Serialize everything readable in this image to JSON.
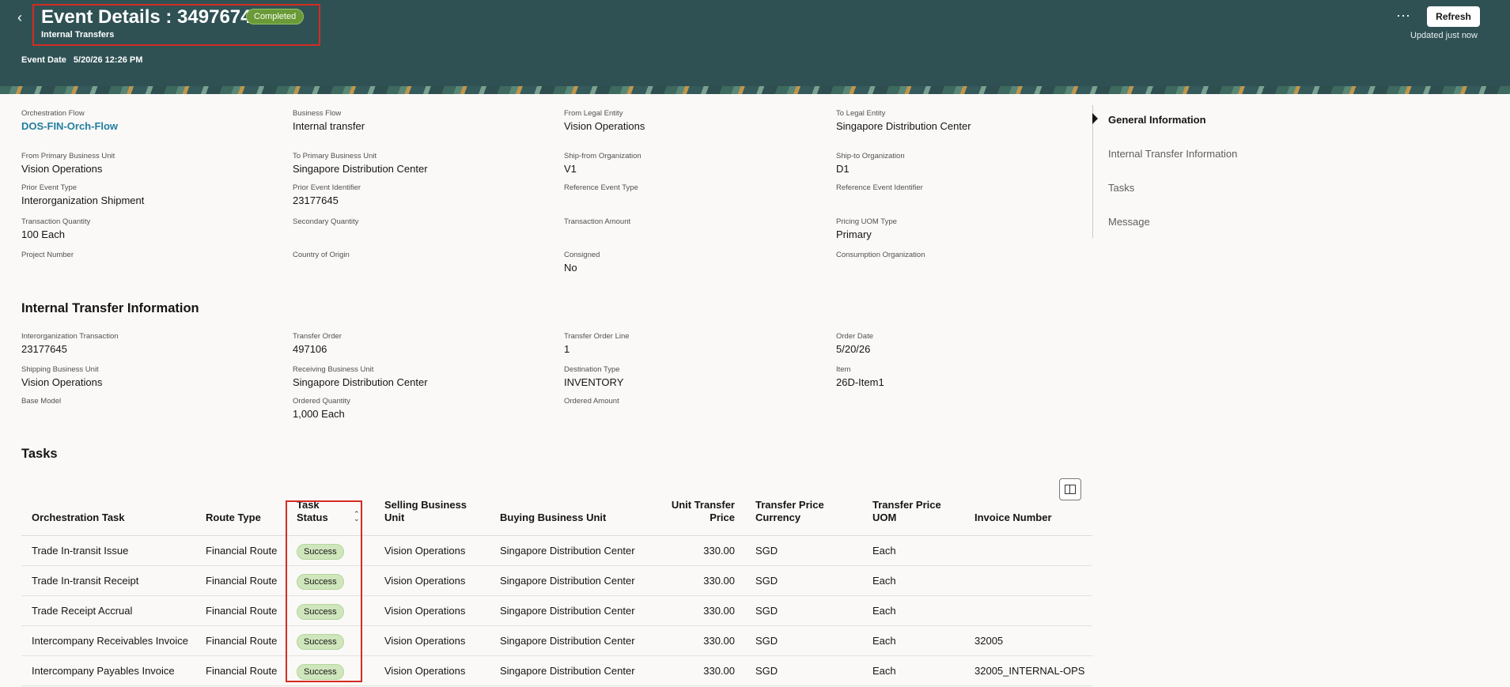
{
  "header": {
    "title": "Event Details : 3497674",
    "status": "Completed",
    "subtitle": "Internal Transfers",
    "event_date_label": "Event Date",
    "event_date_value": "5/20/26 12:26 PM",
    "refresh_label": "Refresh",
    "updated_text": "Updated just now",
    "more_icon": "⋯",
    "back_icon": "‹"
  },
  "general": {
    "fields": [
      {
        "label": "Orchestration Flow",
        "value": "DOS-FIN-Orch-Flow"
      },
      {
        "label": "Business Flow",
        "value": "Internal transfer"
      },
      {
        "label": "From Legal Entity",
        "value": "Vision Operations"
      },
      {
        "label": "To Legal Entity",
        "value": "Singapore Distribution Center"
      },
      {
        "label": "From Primary Business Unit",
        "value": "Vision Operations"
      },
      {
        "label": "To Primary Business Unit",
        "value": "Singapore Distribution Center"
      },
      {
        "label": "Ship-from Organization",
        "value": "V1"
      },
      {
        "label": "Ship-to Organization",
        "value": "D1"
      },
      {
        "label": "Prior Event Type",
        "value": "Interorganization Shipment"
      },
      {
        "label": "Prior Event Identifier",
        "value": "23177645"
      },
      {
        "label": "Reference Event Type",
        "value": ""
      },
      {
        "label": "Reference Event Identifier",
        "value": ""
      },
      {
        "label": "Transaction Quantity",
        "value": "100 Each"
      },
      {
        "label": "Secondary Quantity",
        "value": ""
      },
      {
        "label": "Transaction Amount",
        "value": ""
      },
      {
        "label": "Pricing UOM Type",
        "value": "Primary"
      },
      {
        "label": "Project Number",
        "value": ""
      },
      {
        "label": "Country of Origin",
        "value": ""
      },
      {
        "label": "Consigned",
        "value": "No"
      },
      {
        "label": "Consumption Organization",
        "value": ""
      }
    ]
  },
  "internal_transfer": {
    "title": "Internal Transfer Information",
    "fields": [
      {
        "label": "Interorganization Transaction",
        "value": "23177645"
      },
      {
        "label": "Transfer Order",
        "value": "497106"
      },
      {
        "label": "Transfer Order Line",
        "value": "1"
      },
      {
        "label": "Order Date",
        "value": "5/20/26"
      },
      {
        "label": "Shipping Business Unit",
        "value": "Vision Operations"
      },
      {
        "label": "Receiving Business Unit",
        "value": "Singapore Distribution Center"
      },
      {
        "label": "Destination Type",
        "value": "INVENTORY"
      },
      {
        "label": "Item",
        "value": "26D-Item1"
      },
      {
        "label": "Base Model",
        "value": ""
      },
      {
        "label": "Ordered Quantity",
        "value": "1,000 Each"
      },
      {
        "label": "Ordered Amount",
        "value": ""
      }
    ]
  },
  "nav": {
    "items": [
      "General Information",
      "Internal Transfer Information",
      "Tasks",
      "Message"
    ]
  },
  "tasks": {
    "title": "Tasks",
    "columns": [
      "Orchestration Task",
      "Route Type",
      "Task Status",
      "Selling Business Unit",
      "Buying Business Unit",
      "Unit Transfer Price",
      "Transfer Price Currency",
      "Transfer Price UOM",
      "Invoice Number"
    ],
    "rows": [
      [
        "Trade In-transit Issue",
        "Financial Route",
        "Success",
        "Vision Operations",
        "Singapore Distribution Center",
        "330.00",
        "SGD",
        "Each",
        ""
      ],
      [
        "Trade In-transit Receipt",
        "Financial Route",
        "Success",
        "Vision Operations",
        "Singapore Distribution Center",
        "330.00",
        "SGD",
        "Each",
        ""
      ],
      [
        "Trade Receipt Accrual",
        "Financial Route",
        "Success",
        "Vision Operations",
        "Singapore Distribution Center",
        "330.00",
        "SGD",
        "Each",
        ""
      ],
      [
        "Intercompany Receivables Invoice",
        "Financial Route",
        "Success",
        "Vision Operations",
        "Singapore Distribution Center",
        "330.00",
        "SGD",
        "Each",
        "32005"
      ],
      [
        "Intercompany Payables Invoice",
        "Financial Route",
        "Success",
        "Vision Operations",
        "Singapore Distribution Center",
        "330.00",
        "SGD",
        "Each",
        "32005_INTERNAL-OPS"
      ]
    ]
  }
}
